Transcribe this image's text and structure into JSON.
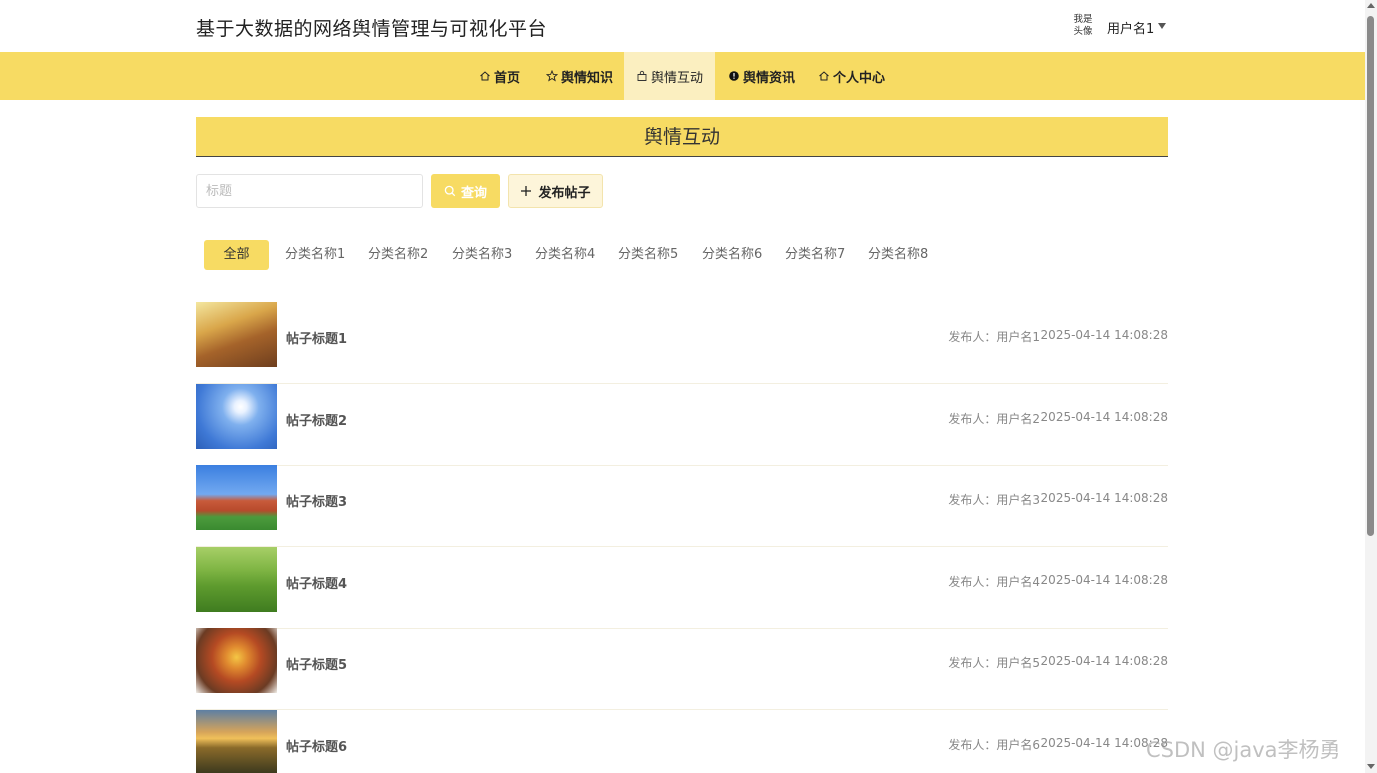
{
  "header": {
    "site_title": "基于大数据的网络舆情管理与可视化平台",
    "avatar_text": "我是头像",
    "user_name": "用户名1"
  },
  "nav": {
    "items": [
      {
        "label": "首页",
        "icon": "home-icon",
        "active": false
      },
      {
        "label": "舆情知识",
        "icon": "star-icon",
        "active": false
      },
      {
        "label": "舆情互动",
        "icon": "bag-icon",
        "active": true
      },
      {
        "label": "舆情资讯",
        "icon": "info-icon",
        "active": false
      },
      {
        "label": "个人中心",
        "icon": "home-icon",
        "active": false
      }
    ]
  },
  "section": {
    "title": "舆情互动"
  },
  "search": {
    "placeholder": "标题",
    "query_label": "查询",
    "publish_label": "发布帖子"
  },
  "categories": [
    "全部",
    "分类名称1",
    "分类名称2",
    "分类名称3",
    "分类名称4",
    "分类名称5",
    "分类名称6",
    "分类名称7",
    "分类名称8"
  ],
  "posts": [
    {
      "title": "帖子标题1",
      "author": "发布人：用户名1",
      "time": "2025-04-14 14:08:28",
      "thumb": "runner-sunset"
    },
    {
      "title": "帖子标题2",
      "author": "发布人：用户名2",
      "time": "2025-04-14 14:08:28",
      "thumb": "sun-sky"
    },
    {
      "title": "帖子标题3",
      "author": "发布人：用户名3",
      "time": "2025-04-14 14:08:28",
      "thumb": "campus-building"
    },
    {
      "title": "帖子标题4",
      "author": "发布人：用户名4",
      "time": "2025-04-14 14:08:28",
      "thumb": "green-hills"
    },
    {
      "title": "帖子标题5",
      "author": "发布人：用户名5",
      "time": "2025-04-14 14:08:28",
      "thumb": "food-plate"
    },
    {
      "title": "帖子标题6",
      "author": "发布人：用户名6",
      "time": "2025-04-14 14:08:28",
      "thumb": "sunset-field"
    }
  ],
  "watermark": "CSDN @java李杨勇",
  "colors": {
    "accent": "#f7db63",
    "active_tab": "#fbefc0",
    "publish_bg": "#fdf5da"
  }
}
